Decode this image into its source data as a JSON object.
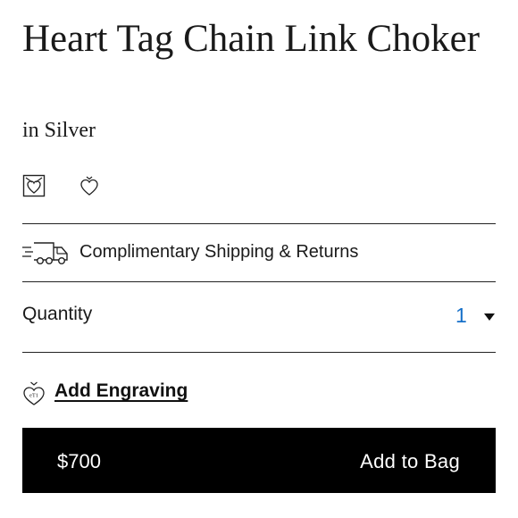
{
  "product": {
    "title": "Heart Tag Chain Link Choker",
    "variant": "in Silver"
  },
  "swatches": [
    {
      "icon": "heart-tag-box-icon"
    },
    {
      "icon": "heart-outline-icon"
    }
  ],
  "shipping": {
    "icon": "delivery-truck-icon",
    "label": "Complimentary Shipping & Returns"
  },
  "quantity": {
    "label": "Quantity",
    "value": "1",
    "value_color": "#1670c9"
  },
  "engraving": {
    "icon": "heart-tag-engraving-icon",
    "label": "Add Engraving"
  },
  "cta": {
    "price": "$700",
    "label": "Add to Bag",
    "background": "#000000"
  }
}
